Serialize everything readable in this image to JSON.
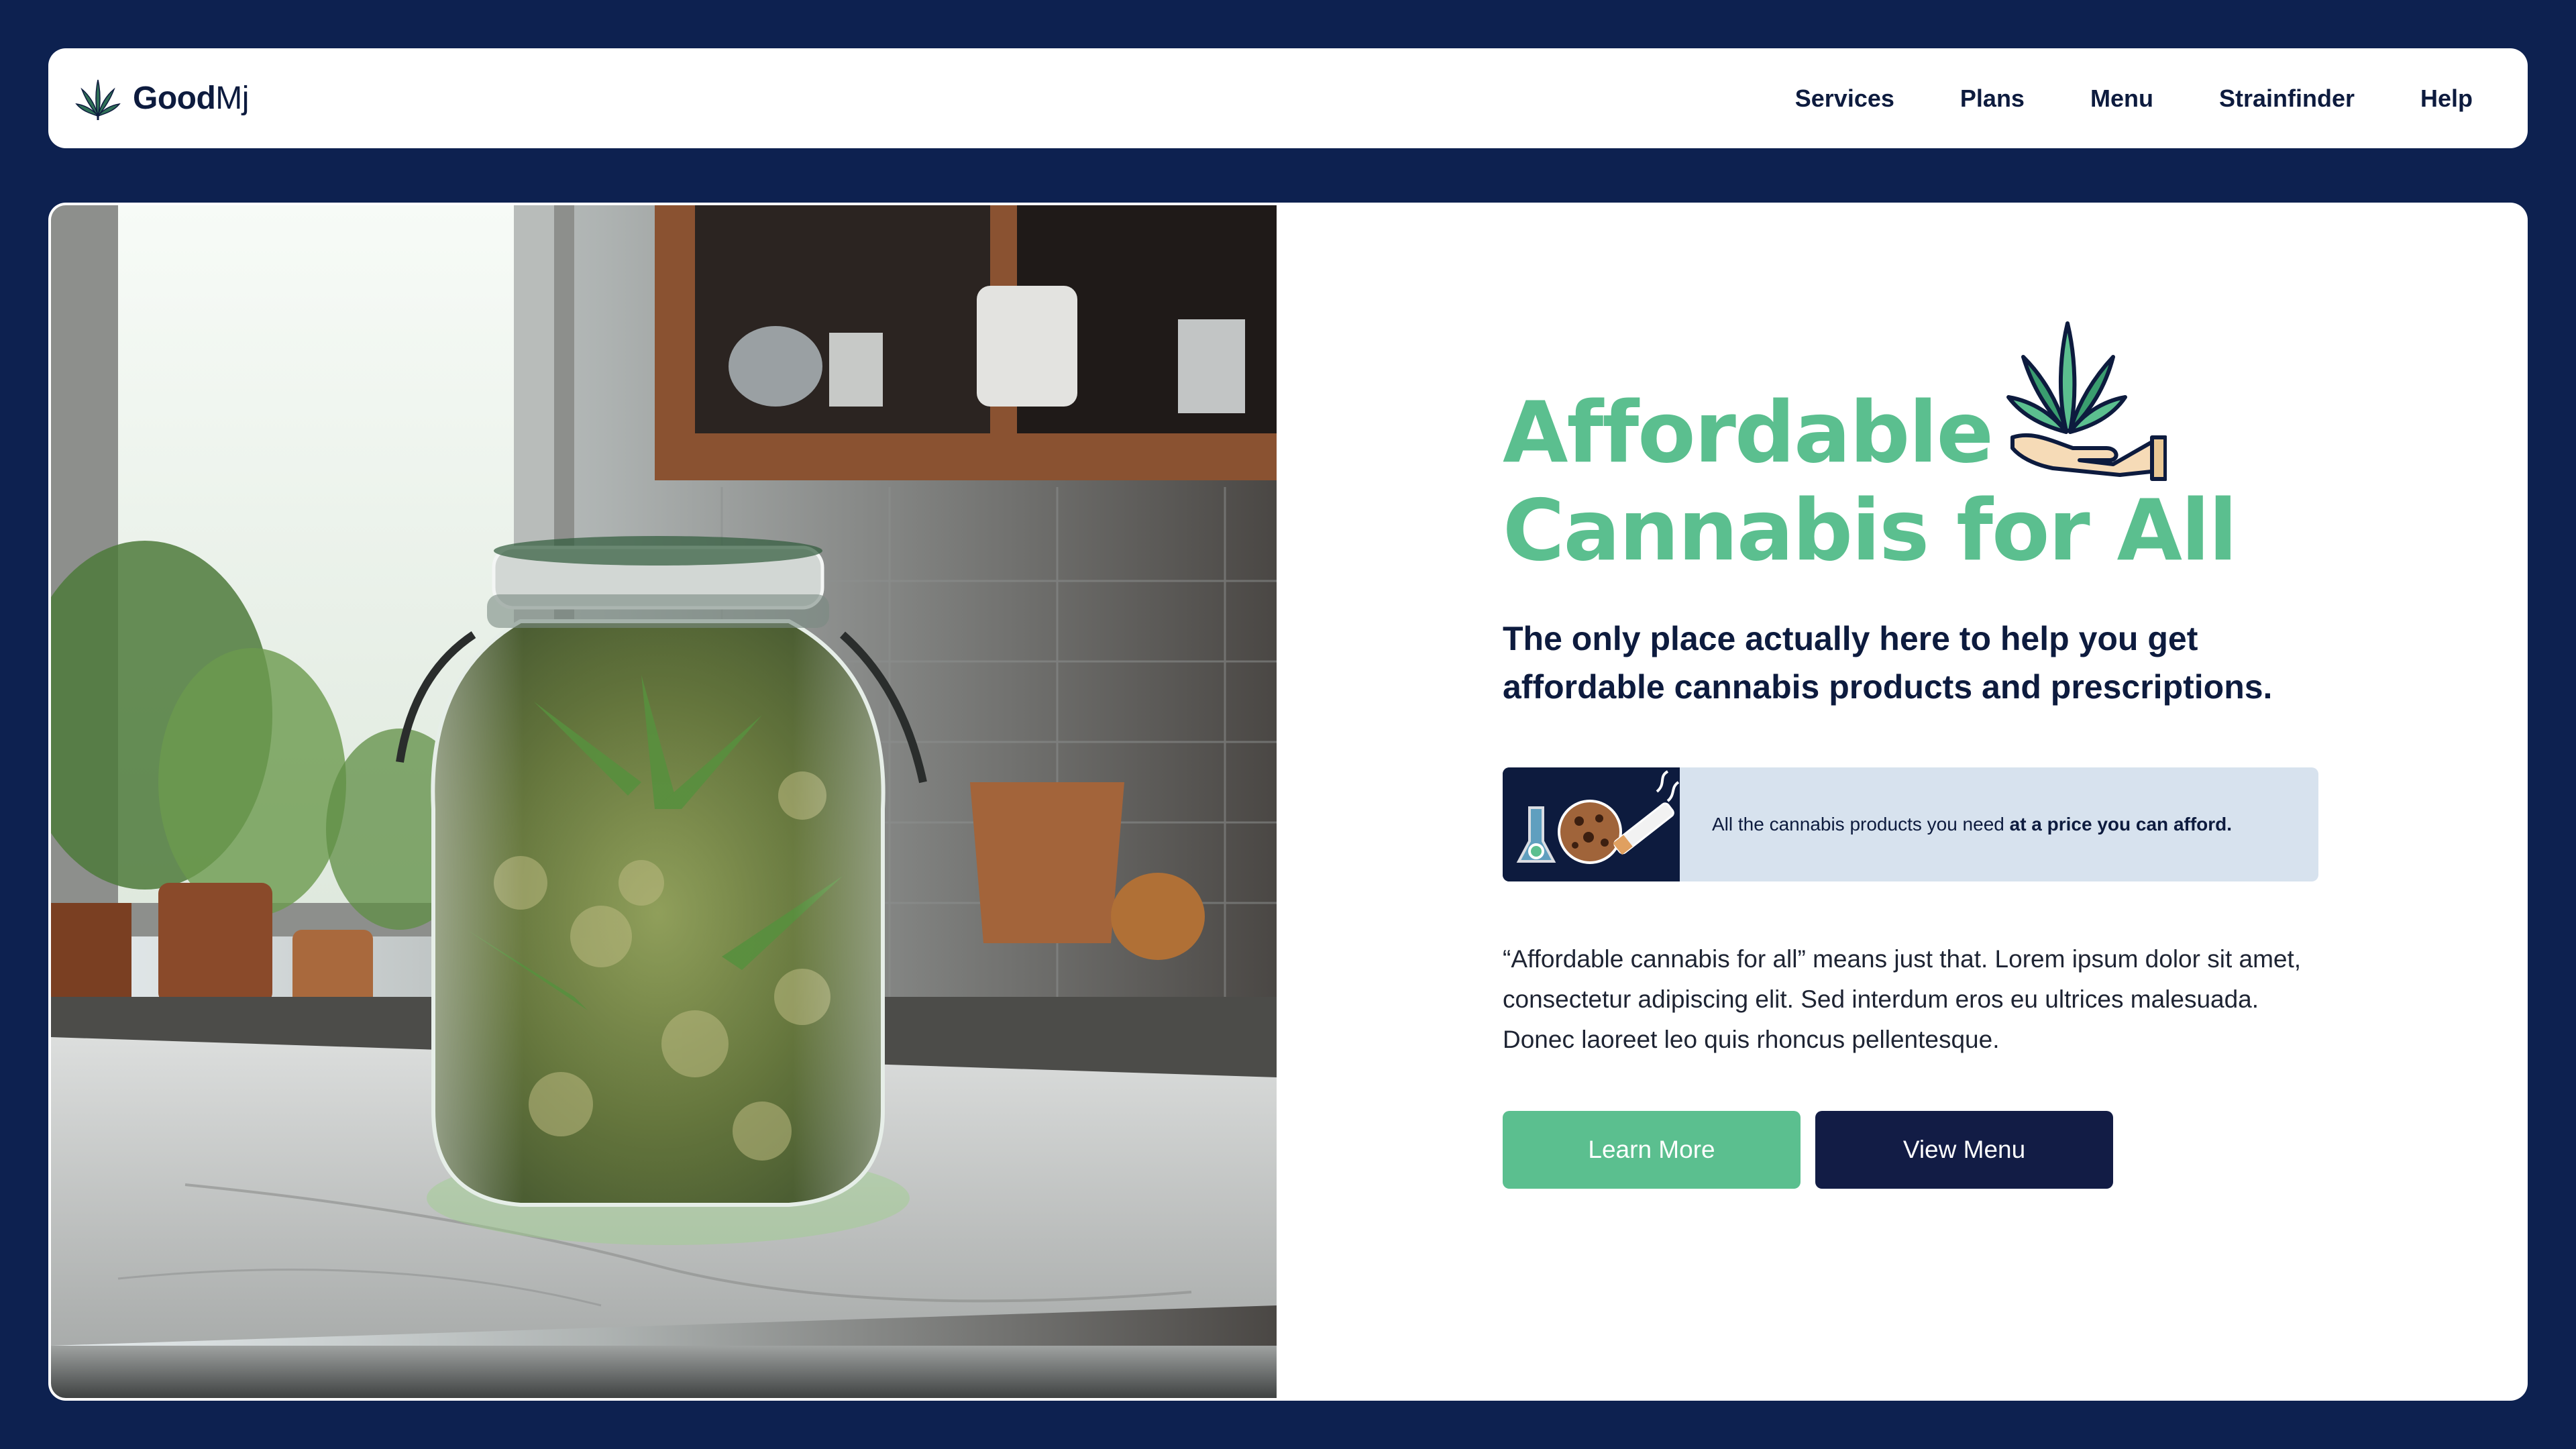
{
  "brand": {
    "name_bold": "Good",
    "name_light": "Mj",
    "icon": "cannabis-leaf-icon"
  },
  "nav": {
    "items": [
      {
        "label": "Services"
      },
      {
        "label": "Plans"
      },
      {
        "label": "Menu"
      },
      {
        "label": "Strainfinder"
      },
      {
        "label": "Help"
      }
    ]
  },
  "hero": {
    "image": "cannabis-jar-on-kitchen-counter-photo",
    "headline_line1": "Affordable",
    "headline_line2": "Cannabis for All",
    "headline_icon": "hand-holding-cannabis-leaf-icon",
    "subheadline": "The only place actually here to help you get affordable cannabis products and prescriptions.",
    "promo": {
      "image": "bong-cookie-joint-illustration",
      "text_regular": "All the cannabis products you need ",
      "text_bold": "at a price you can afford."
    },
    "body": "“Affordable cannabis for all” means just that. Lorem ipsum dolor sit amet, consectetur adipiscing elit. Sed interdum eros eu ultrices malesuada. Donec laoreet leo quis rhoncus pellentesque.",
    "buttons": {
      "learn_more": "Learn More",
      "view_menu": "View Menu"
    }
  },
  "colors": {
    "background": "#0d2150",
    "accent_green": "#5bbf8f",
    "navy": "#0d1b3e",
    "promo_bg": "#d7e2ee"
  }
}
